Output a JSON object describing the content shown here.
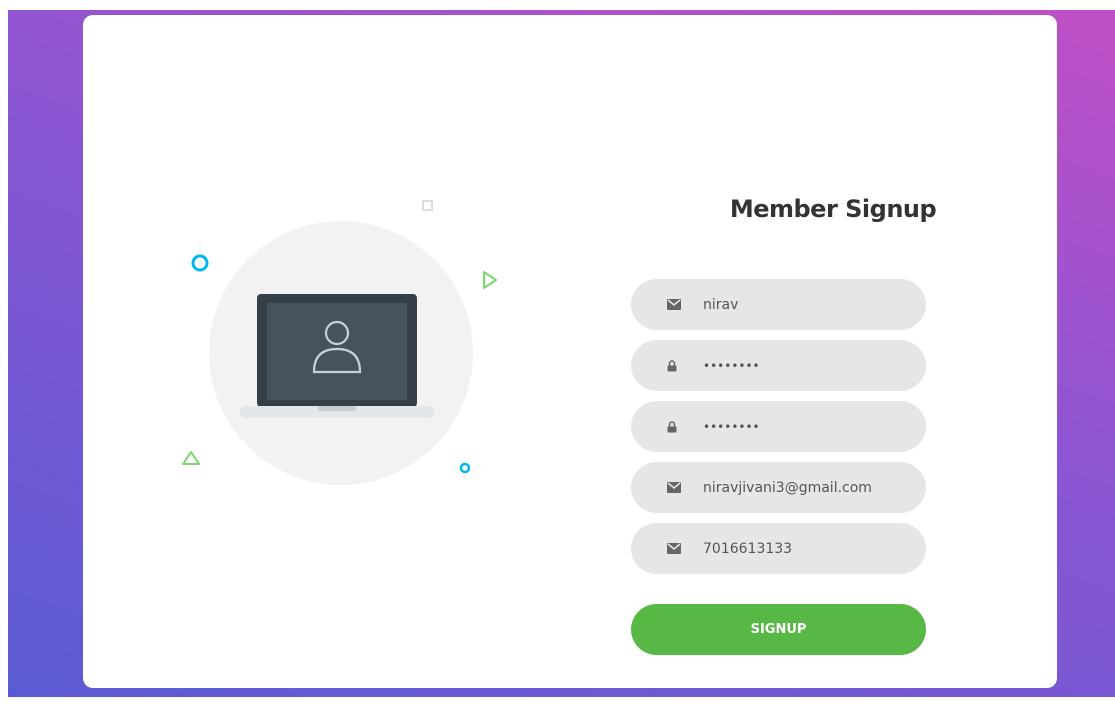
{
  "form": {
    "title": "Member Signup",
    "fields": [
      {
        "icon": "envelope-icon",
        "value": "nirav",
        "type": "text"
      },
      {
        "icon": "lock-icon",
        "value": "••••••••",
        "type": "password"
      },
      {
        "icon": "lock-icon",
        "value": "••••••••",
        "type": "password"
      },
      {
        "icon": "envelope-icon",
        "value": "niravjivani3@gmail.com",
        "type": "email"
      },
      {
        "icon": "envelope-icon",
        "value": "7016613133",
        "type": "tel"
      }
    ],
    "submit_label": "SIGNUP"
  },
  "colors": {
    "gradient_start": "#c04fc6",
    "gradient_end": "#5a5bd4",
    "button_green": "#57b846",
    "field_bg": "#e6e6e6",
    "accent_cyan": "#00b8f0",
    "accent_green": "#7dd56f"
  },
  "illustration": {
    "icons": [
      "laptop-icon",
      "user-icon",
      "circle-icon",
      "triangle-icon",
      "square-icon"
    ]
  }
}
